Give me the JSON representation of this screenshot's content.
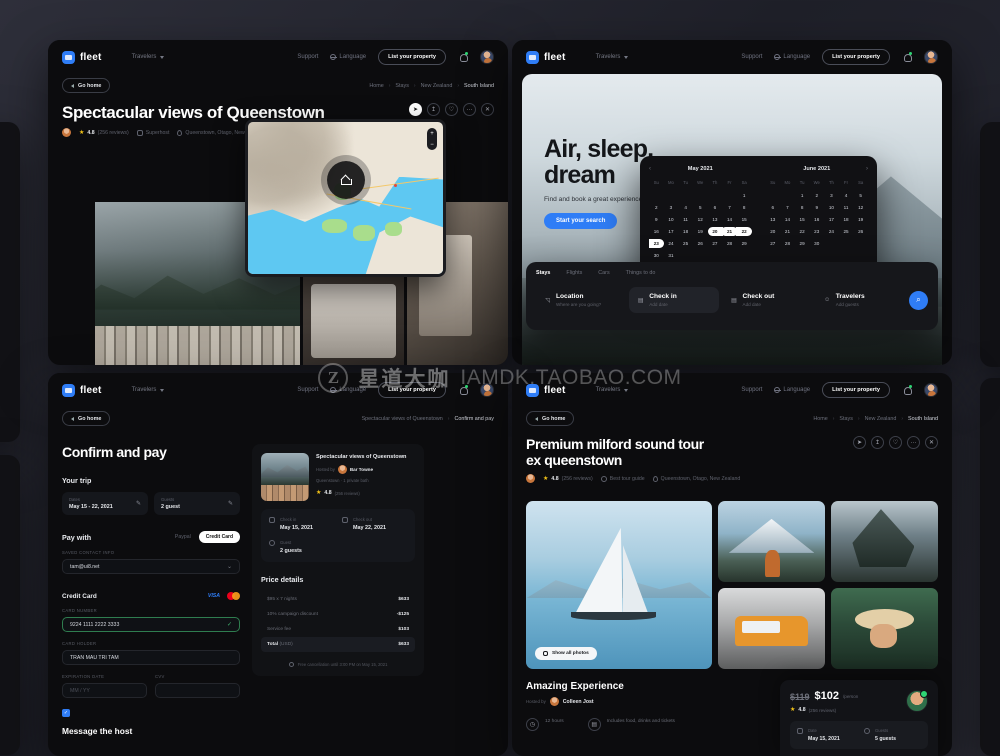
{
  "watermark": {
    "mark": "Z",
    "chinese": "星道大咖",
    "latin": "IAMDK.TAOBAO.COM"
  },
  "nav": {
    "brand": "fleet",
    "travelers": "Travelers",
    "support": "Support",
    "language": "Language",
    "list_property": "List your property",
    "bell_icon": "bell-icon",
    "avatar_icon": "avatar-icon"
  },
  "subnav": {
    "go_home": "Go home",
    "crumbs_stay": [
      "Home",
      "Stays",
      "New Zealand",
      "South Island"
    ],
    "crumbs_pay": [
      "Spectacular views of Queenstown",
      "Confirm and pay"
    ]
  },
  "listing": {
    "title": "Spectacular views of Queenstown",
    "rating": "4.8",
    "reviews": "(256 reviews)",
    "superhost": "Superhost",
    "location": "Queenstown, Otago, New Zealand",
    "actions": [
      "send-icon",
      "share-icon",
      "heart-icon",
      "more-icon",
      "close-icon"
    ]
  },
  "map": {
    "marker_icon": "home-marker-icon",
    "zoom_in": "+",
    "zoom_out": "−"
  },
  "hero": {
    "title_line1": "Air, sleep,",
    "title_line2": "dream",
    "subtitle": "Find and book a great experience",
    "cta": "Start your search"
  },
  "calendar": {
    "prev_icon": "chevron-left-icon",
    "next_icon": "chevron-right-icon",
    "dow": [
      "Su",
      "Mo",
      "Tu",
      "We",
      "Th",
      "Fr",
      "Sa"
    ],
    "months": [
      {
        "title": "May 2021",
        "lead_blanks": 6,
        "days": 31,
        "selected": [
          20,
          21,
          22,
          23
        ]
      },
      {
        "title": "June 2021",
        "lead_blanks": 2,
        "days": 30,
        "selected": []
      }
    ]
  },
  "search": {
    "tabs": [
      "Stays",
      "Flights",
      "Cars",
      "Things to do"
    ],
    "active_tab": "Stays",
    "fields": [
      {
        "icon": "location-icon",
        "label": "Location",
        "sub": "Where are you going?",
        "active": false
      },
      {
        "icon": "calendar-icon",
        "label": "Check in",
        "sub": "Add date",
        "active": true
      },
      {
        "icon": "calendar-icon",
        "label": "Check out",
        "sub": "Add date",
        "active": false
      },
      {
        "icon": "person-icon",
        "label": "Travelers",
        "sub": "Add guests",
        "active": false
      }
    ],
    "go_icon": "search-icon"
  },
  "confirm": {
    "title": "Confirm and pay",
    "your_trip": "Your trip",
    "trip": [
      {
        "label": "Dates",
        "value": "May 15 - 22, 2021",
        "edit_icon": "pencil-icon"
      },
      {
        "label": "Guests",
        "value": "2 guest",
        "edit_icon": "pencil-icon"
      }
    ],
    "pay_with": "Pay with",
    "pay_paypal": "Paypal",
    "pay_card": "Credit Card",
    "saved_contact_label": "SAVED CONTACT INFO",
    "saved_contact_value": "tam@ui8.net",
    "credit_card": "Credit Card",
    "visa": "VISA",
    "card_number_label": "CARD NUMBER",
    "card_number_value": "9224 1111 2222 3333",
    "card_holder_label": "CARD HOLDER",
    "card_holder_value": "TRAN MAU TRI TAM",
    "expiration_label": "EXPIRATION DATE",
    "expiration_placeholder": "MM / YY",
    "cvv_label": "CVV",
    "cvv_placeholder": "",
    "checkbox_icon": "checkbox-checked-icon",
    "message_host": "Message the host"
  },
  "summary": {
    "title": "Spectacular views of Queenstown",
    "hosted_by": "Hosted by",
    "host": "Bar Towne",
    "sub": "Queenstown · 1 private bath",
    "rating": "4.8",
    "reviews": "(256 reviews)",
    "check_in_label": "Check in",
    "check_in_value": "May 15, 2021",
    "check_out_label": "Check out",
    "check_out_value": "May 22, 2021",
    "guests_label": "Guest",
    "guests_value": "2 guests",
    "price_details": "Price details",
    "rows": [
      {
        "label": "$95 x 7 nights",
        "value": "$633"
      },
      {
        "label": "10% campaign discount",
        "value": "-$125"
      },
      {
        "label": "Service fee",
        "value": "$103"
      }
    ],
    "total_label": "Total",
    "total_currency": "(USD)",
    "total_value": "$633",
    "note_icon": "info-icon",
    "note": "Free cancellation until 3:00 PM on May 15, 2021"
  },
  "tour": {
    "title_line1": "Premium milford sound tour",
    "title_line2": "ex queenstown",
    "rating": "4.8",
    "reviews": "(256 reviews)",
    "badge": "Best tour guide",
    "location": "Queenstown, Otago, New Zealand",
    "show_all_photos": "Show all photos",
    "show_all_icon": "grid-icon",
    "experience_title": "Amazing Experience",
    "hosted_by": "Hosted by",
    "host": "Colleen Jost",
    "features": [
      {
        "icon": "clock-icon",
        "text": "12 hours"
      },
      {
        "icon": "ticket-icon",
        "text": "Includes food, drinks and tickets"
      }
    ],
    "price_old": "$119",
    "price_new": "$102",
    "price_per": "/person",
    "price_rating": "4.8",
    "price_reviews": "(256 reviews)",
    "booking": [
      {
        "icon": "calendar-icon",
        "label": "Date",
        "value": "May 15, 2021"
      },
      {
        "icon": "person-icon",
        "label": "Guests",
        "value": "5 guests"
      }
    ]
  }
}
